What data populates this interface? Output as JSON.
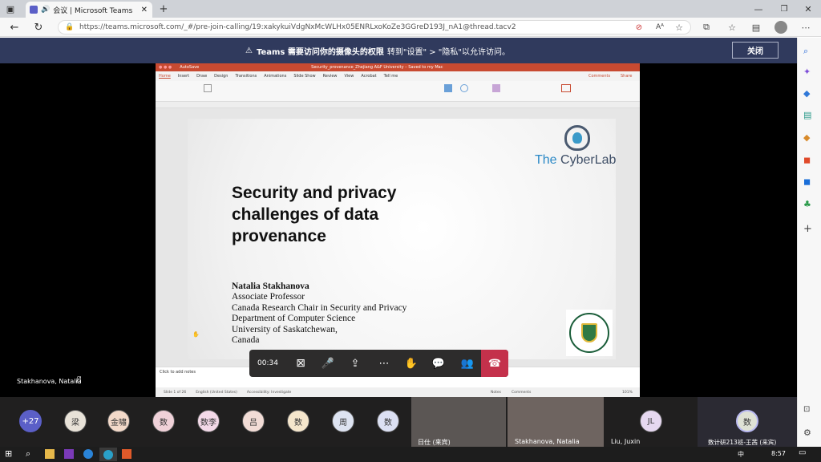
{
  "browser": {
    "tab_title": "会议 | Microsoft Teams",
    "url": "https://teams.microsoft.com/_#/pre-join-calling/19:xakykuiVdgNxMcWLHx05ENRLxoKoZe3GGreD193J_nA1@thread.tacv2"
  },
  "notice": {
    "bold": "Teams 需要访问你的摄像头的权限",
    "rest": "转到\"设置\" > \"隐私\"以允许访问。",
    "button": "关闭"
  },
  "ppt": {
    "autosave": "AutoSave",
    "doc_title": "Security_provenance_Zhejiang A&F University – Saved to my Mac",
    "tabs": [
      "Home",
      "Insert",
      "Draw",
      "Design",
      "Transitions",
      "Animations",
      "Slide Show",
      "Review",
      "View",
      "Acrobat",
      "Tell me"
    ],
    "comments": "Comments",
    "share": "Share",
    "notes": "Click to add notes",
    "status": "Slide 1 of 26",
    "lang": "English (United States)",
    "access": "Accessibility: Investigate",
    "notes_btn": "Notes",
    "comments_btn": "Comments",
    "zoom": "101%"
  },
  "slide": {
    "title_lines": [
      "Security and privacy",
      "challenges of data",
      "provenance"
    ],
    "author": "Natalia Stakhanova",
    "affil": [
      "Associate Professor",
      "Canada Research Chair in Security and Privacy",
      "Department of Computer Science",
      "University of Saskatchewan,",
      "Canada"
    ],
    "logo_the": "The",
    "logo_lab": "CyberLab",
    "seal_text": "UNIVERSITY OF SASKATCHEWAN"
  },
  "call": {
    "timer": "00:34",
    "presenter_label": "Stakhanova, Natalia"
  },
  "participants": {
    "more": "+27",
    "avatars": [
      {
        "text": "梁",
        "color": "#e8e2d8"
      },
      {
        "text": "金嘯",
        "color": "#f3d9c9"
      },
      {
        "text": "数",
        "color": "#efd1d8"
      },
      {
        "text": "数李",
        "color": "#f3d9e8"
      },
      {
        "text": "吕",
        "color": "#f2dcd6"
      },
      {
        "text": "数",
        "color": "#f5e6cc"
      },
      {
        "text": "周",
        "color": "#dde3f1"
      },
      {
        "text": "数",
        "color": "#dce0f3"
      }
    ],
    "video1": "日仕 (来宾)",
    "video2": "Stakhanova, Natalia",
    "jl_initials": "JL",
    "jl_name": "Liu, Juxin",
    "last_initial": "数",
    "last_name": "数计研213班-王茜 (来宾)"
  },
  "taskbar": {
    "time": "8:57",
    "ime": "中"
  }
}
